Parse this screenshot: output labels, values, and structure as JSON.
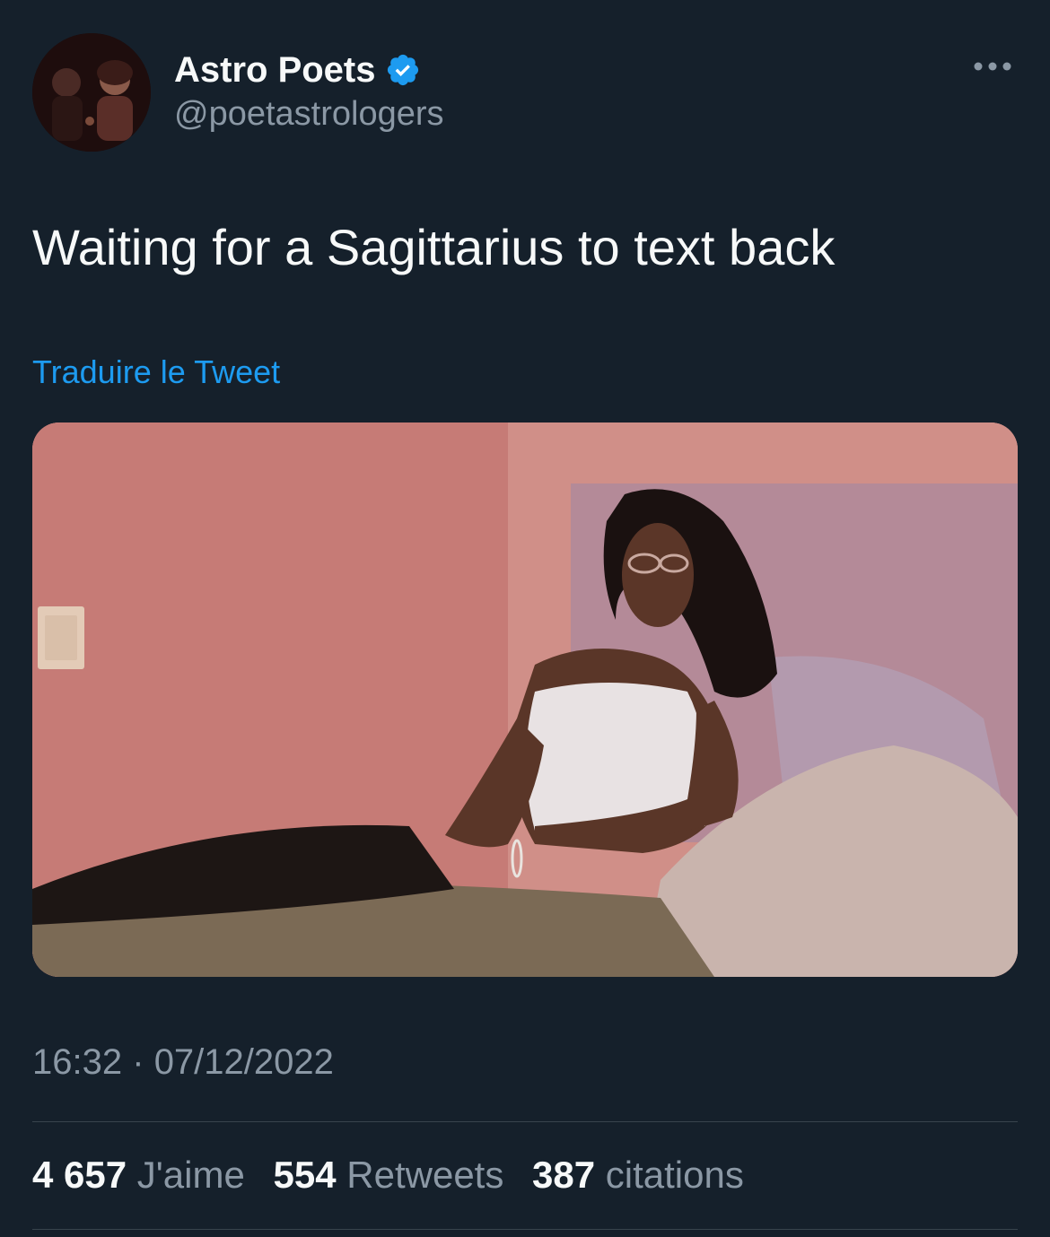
{
  "author": {
    "display_name": "Astro Poets",
    "handle": "@poetastrologers",
    "verified": true,
    "avatar_icon": "profile-photo-avatar",
    "verified_icon": "verified-badge-icon"
  },
  "menu": {
    "more_icon": "more-options-icon"
  },
  "tweet": {
    "text": "Waiting for a Sagittarius to text back",
    "translate_label": "Traduire le Tweet",
    "media_alt": "photo of a woman sitting on a bed waiting"
  },
  "meta": {
    "time": "16:32",
    "separator": "·",
    "date": "07/12/2022"
  },
  "stats": {
    "likes": {
      "count": "4 657",
      "label": "J'aime"
    },
    "retweets": {
      "count": "554",
      "label": "Retweets"
    },
    "quotes": {
      "count": "387",
      "label": "citations"
    }
  },
  "colors": {
    "background": "#15202b",
    "text_primary": "#f7f9f9",
    "text_secondary": "#8b98a5",
    "accent": "#1d9bf0",
    "divider": "#38444d"
  }
}
